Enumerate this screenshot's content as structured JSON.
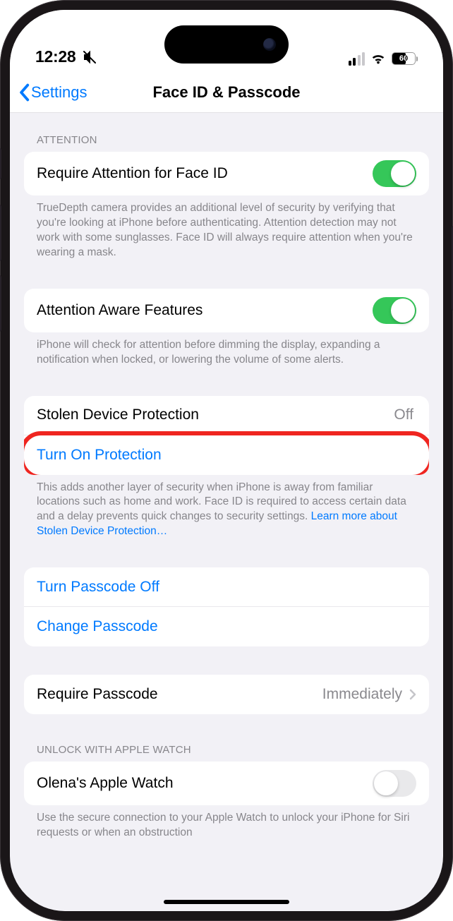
{
  "status": {
    "time": "12:28",
    "battery": "60"
  },
  "nav": {
    "back": "Settings",
    "title": "Face ID & Passcode"
  },
  "sections": {
    "attention": {
      "header": "ATTENTION",
      "row1": {
        "label": "Require Attention for Face ID",
        "footer": "TrueDepth camera provides an additional level of security by verifying that you're looking at iPhone before authenticating. Attention detection may not work with some sunglasses. Face ID will always require attention when you're wearing a mask."
      },
      "row2": {
        "label": "Attention Aware Features",
        "footer": "iPhone will check for attention before dimming the display, expanding a notification when locked, or lowering the volume of some alerts."
      }
    },
    "stolen": {
      "status_label": "Stolen Device Protection",
      "status_value": "Off",
      "action": "Turn On Protection",
      "footer_text": "This adds another layer of security when iPhone is away from familiar locations such as home and work. Face ID is required to access certain data and a delay prevents quick changes to security settings. ",
      "footer_link": "Learn more about Stolen Device Protection…"
    },
    "passcode": {
      "turn_off": "Turn Passcode Off",
      "change": "Change Passcode"
    },
    "require": {
      "label": "Require Passcode",
      "value": "Immediately"
    },
    "watch": {
      "header": "UNLOCK WITH APPLE WATCH",
      "label": "Olena's Apple Watch",
      "footer": "Use the secure connection to your Apple Watch to unlock your iPhone for Siri requests or when an obstruction"
    }
  }
}
